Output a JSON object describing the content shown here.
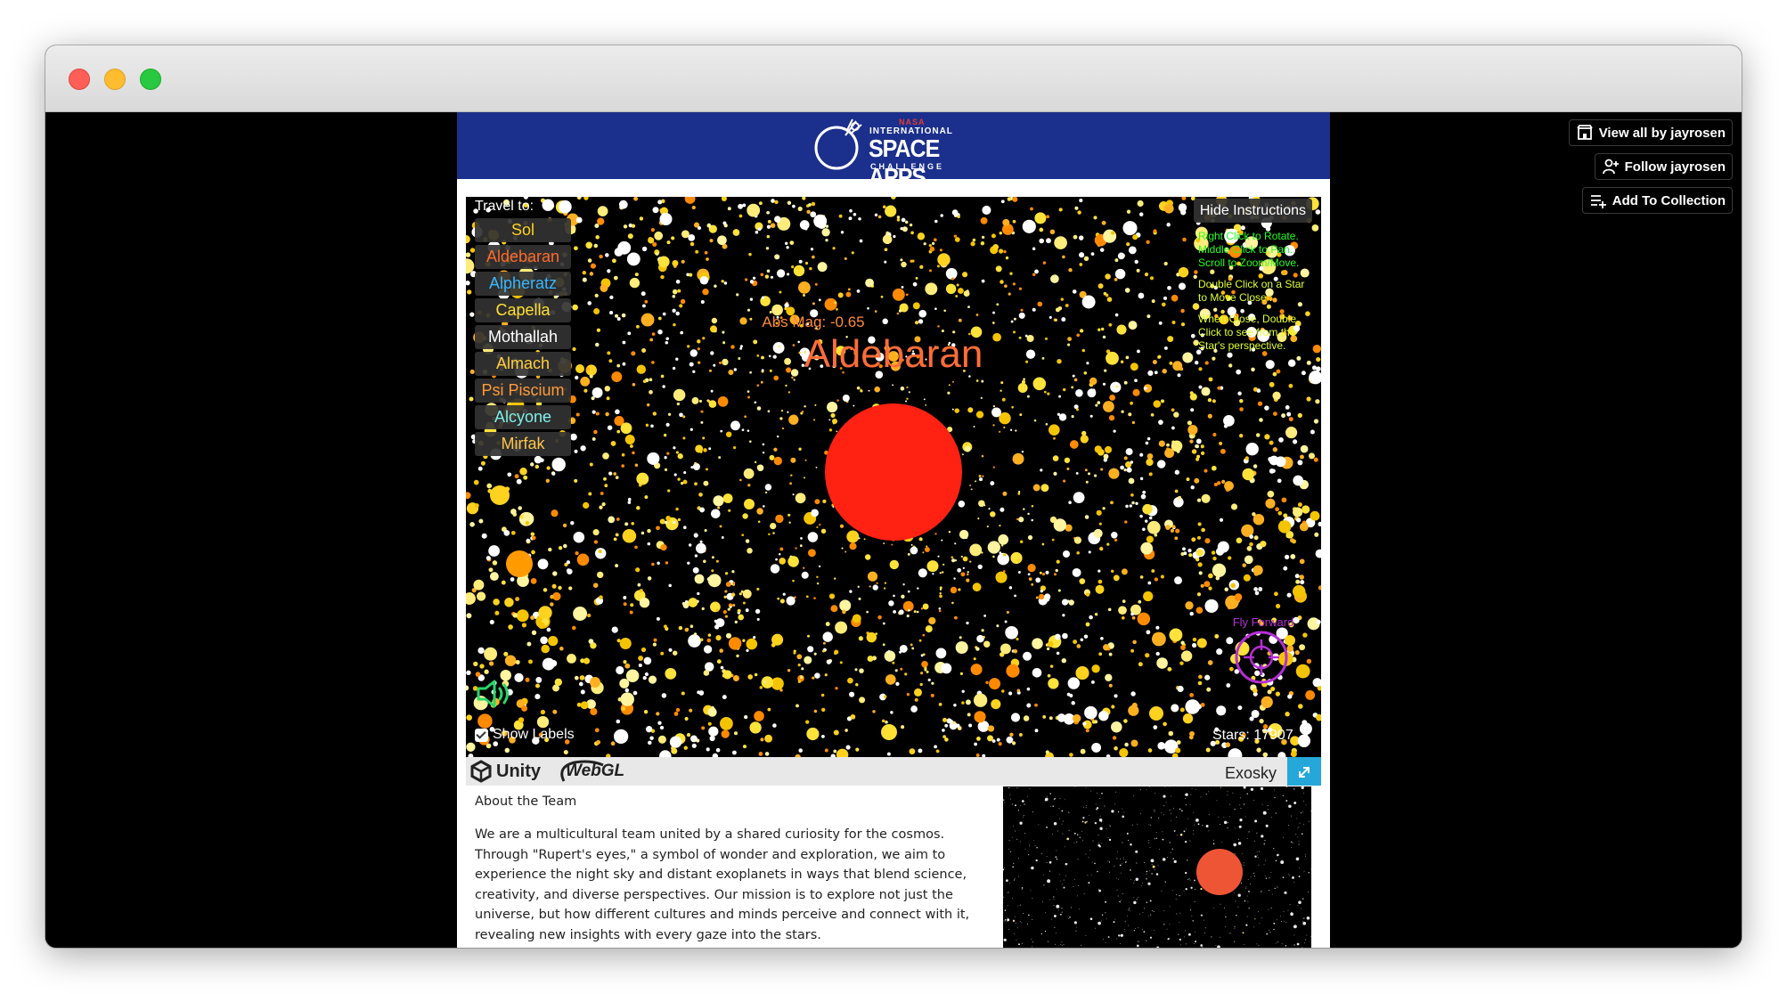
{
  "side_buttons": {
    "view_all": "View all by jayrosen",
    "follow": "Follow jayrosen",
    "add_collection": "Add To Collection"
  },
  "banner": {
    "logo_line_nasa": "NASA",
    "logo_line1": "INTERNATIONAL",
    "logo_line2": "SPACE APPS",
    "logo_line3": "CHALLENGE"
  },
  "game": {
    "travel_title": "Travel to:",
    "destinations": [
      {
        "label": "Sol",
        "color": "#ffd21f"
      },
      {
        "label": "Aldebaran",
        "color": "#ff6a2a"
      },
      {
        "label": "Alpheratz",
        "color": "#39b7ff"
      },
      {
        "label": "Capella",
        "color": "#ffe033"
      },
      {
        "label": "Mothallah",
        "color": "#ffffff"
      },
      {
        "label": "Almach",
        "color": "#ffd040"
      },
      {
        "label": "Psi Piscium",
        "color": "#ff9a3a"
      },
      {
        "label": "Alcyone",
        "color": "#7ff0e8"
      },
      {
        "label": "Mirfak",
        "color": "#ffc64a"
      }
    ],
    "hide_instructions": "Hide Instructions",
    "instructions": [
      "Right Click to Rotate.\nMiddle Click to Pan.\nScroll to Zoom/Move.",
      "Double Click on a Star to Move Closer.",
      "When Close, Double Click to see from the Star's perspective."
    ],
    "abs_mag": "Abs Mag: -0.65",
    "star_name": "Aldebaran",
    "star_color": "#ff2212",
    "fly_forward": "Fly Forward",
    "show_labels": "Show Labels",
    "stars_count": "Stars: 17907"
  },
  "game_bar": {
    "unity": "Unity",
    "webgl": "WebGL",
    "title": "Exosky"
  },
  "about": {
    "title": "About the Team",
    "text": "We are a multicultural team united by a shared curiosity for the cosmos. Through \"Rupert's eyes,\" a symbol of wonder and exploration, we aim to experience the night sky and distant exoplanets in ways that blend science, creativity, and diverse perspectives. Our mission is to explore not just the universe, but how different cultures and minds perceive and connect with it, revealing new insights with every gaze into the stars."
  },
  "colors": {
    "banner": "#1b2f8c",
    "fullscreen": "#25a7d9",
    "fly_forward": "#b52ed6",
    "instructions_green": "#22ff22"
  }
}
